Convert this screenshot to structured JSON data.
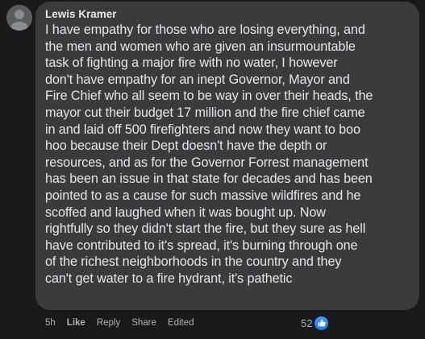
{
  "comment": {
    "author": "Lewis Kramer",
    "text": "I have empathy for those who are losing everything, and\nthe men and women who are given an insurmountable\ntask of fighting a major fire with no water, I however\ndon't have empathy for an inept Governor, Mayor and\nFire Chief who all seem to be way in over their heads, the\nmayor cut their budget 17 million and the fire chief came\nin and laid off 500 firefighters and now they want to boo\nhoo because their Dept doesn't have the depth or\nresources, and as for the Governor Forrest management\nhas been an issue in that state for decades and has been\npointed to as a cause for such massive wildfires and he\nscoffed and laughed when it was bought up. Now\nrightfully so they didn't start the fire, but they sure as hell\nhave contributed to it's spread, it's burning through one\nof the richest neighborhoods in the country and they\ncan't get water to a fire hydrant, it's pathetic",
    "time": "5h",
    "like_label": "Like",
    "reply_label": "Reply",
    "share_label": "Share",
    "edited_label": "Edited",
    "reaction_count": "52",
    "reaction_icon": "thumbs-up-icon"
  },
  "colors": {
    "background": "#18191a",
    "bubble": "#3a3b3c",
    "text": "#e4e6eb",
    "secondary_text": "#b0b3b8",
    "like_blue": "#1877f2"
  }
}
